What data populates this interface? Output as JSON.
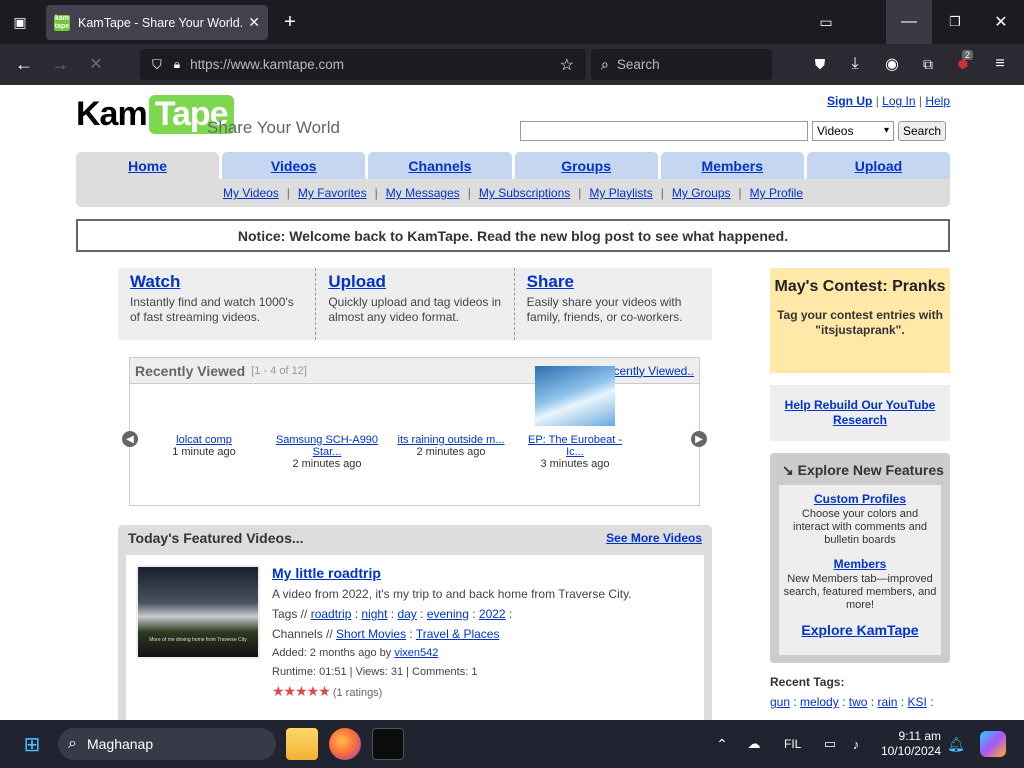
{
  "browser": {
    "tab_title": "KamTape - Share Your World.",
    "url": "https://www.kamtape.com",
    "search_placeholder": "Search",
    "badge_count": "2"
  },
  "site": {
    "logo_kam": "Kam",
    "logo_tape": "Tape",
    "tagline": "Share Your World",
    "signup": "Sign Up",
    "login": "Log In",
    "help": "Help",
    "search_select": "Videos",
    "search_button": "Search"
  },
  "nav": {
    "tabs": [
      "Home",
      "Videos",
      "Channels",
      "Groups",
      "Members",
      "Upload"
    ],
    "sub": [
      "My Videos",
      "My Favorites",
      "My Messages",
      "My Subscriptions",
      "My Playlists",
      "My Groups",
      "My Profile"
    ]
  },
  "notice": "Notice: Welcome back to KamTape. Read the new blog post to see what happened.",
  "intro": [
    {
      "title": "Watch",
      "desc": "Instantly find and watch 1000's of fast streaming videos."
    },
    {
      "title": "Upload",
      "desc": "Quickly upload and tag videos in almost any video format."
    },
    {
      "title": "Share",
      "desc": "Easily share your videos with family, friends, or co-workers."
    }
  ],
  "recently_viewed": {
    "title": "Recently Viewed",
    "count": "[1 - 4 of 12]",
    "more": "More Recently Viewed..",
    "ff": "▷▷",
    "items": [
      {
        "title": "lolcat comp",
        "time": "1 minute ago"
      },
      {
        "title": "Samsung SCH-A990 Star...",
        "time": "2 minutes ago"
      },
      {
        "title": "its raining outside m...",
        "time": "2 minutes ago"
      },
      {
        "title": "EP: The Eurobeat - Ic...",
        "time": "3 minutes ago"
      }
    ]
  },
  "featured": {
    "title": "Today's Featured Videos...",
    "see_more": "See More Videos",
    "video": {
      "title": "My little roadtrip",
      "desc": "A video from 2022, it's my trip to and back home from Traverse City.",
      "thumb_caption": "More of me driving home from Traverse City",
      "tags_label": "Tags //",
      "tags": [
        "roadtrip",
        "night",
        "day",
        "evening",
        "2022"
      ],
      "channels_label": "Channels //",
      "channels": [
        "Short Movies",
        "Travel & Places"
      ],
      "added": "Added: 2 months ago by",
      "author": "vixen542",
      "stats": "Runtime: 01:51 | Views: 31 | Comments: 1",
      "stars": "★★★★★",
      "ratings": "(1 ratings)"
    }
  },
  "contest": {
    "title": "May's Contest: Pranks",
    "desc": "Tag your contest entries with \"itsjustaprank\"."
  },
  "rebuild": "Help Rebuild Our YouTube Research",
  "explore": {
    "title": "Explore New Features",
    "f1_title": "Custom Profiles",
    "f1_desc": "Choose your colors and interact with comments and bulletin boards",
    "f2_title": "Members",
    "f2_desc": "New Members tab—improved search, featured members, and more!",
    "link": "Explore KamTape"
  },
  "tags": {
    "title": "Recent Tags:",
    "items": [
      "gun",
      "melody",
      "two",
      "rain",
      "KSI"
    ]
  },
  "taskbar": {
    "search": "Maghanap",
    "lang": "FIL",
    "time": "9:11 am",
    "date": "10/10/2024"
  }
}
